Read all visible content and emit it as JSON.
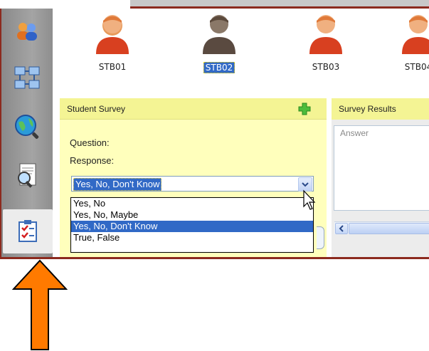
{
  "sidebar": {
    "items": [
      {
        "icon": "users-icon"
      },
      {
        "icon": "network-icon"
      },
      {
        "icon": "globe-search-icon"
      },
      {
        "icon": "document-search-icon"
      },
      {
        "icon": "checklist-icon",
        "active": true
      }
    ]
  },
  "students": [
    {
      "name": "STB01",
      "selected": false,
      "avatar_color": "#e07a3a"
    },
    {
      "name": "STB02",
      "selected": true,
      "avatar_color": "#6d5a4c"
    },
    {
      "name": "STB03",
      "selected": false,
      "avatar_color": "#e07a3a"
    },
    {
      "name": "STB04",
      "selected": false,
      "avatar_color": "#e07a3a"
    }
  ],
  "survey": {
    "title": "Student Survey",
    "question_label": "Question:",
    "response_label": "Response:",
    "selected_value": "Yes, No, Don't Know",
    "options": [
      "Yes, No",
      "Yes, No, Maybe",
      "Yes, No, Don't Know",
      "True, False"
    ],
    "selected_index": 2
  },
  "results": {
    "title": "Survey Results",
    "column_header": "Answer"
  },
  "colors": {
    "frame": "#8c2a1e",
    "panel_header": "#f4f494",
    "panel_body": "#ffffbc",
    "selection": "#3169c6",
    "arrow": "#ff7a00"
  }
}
